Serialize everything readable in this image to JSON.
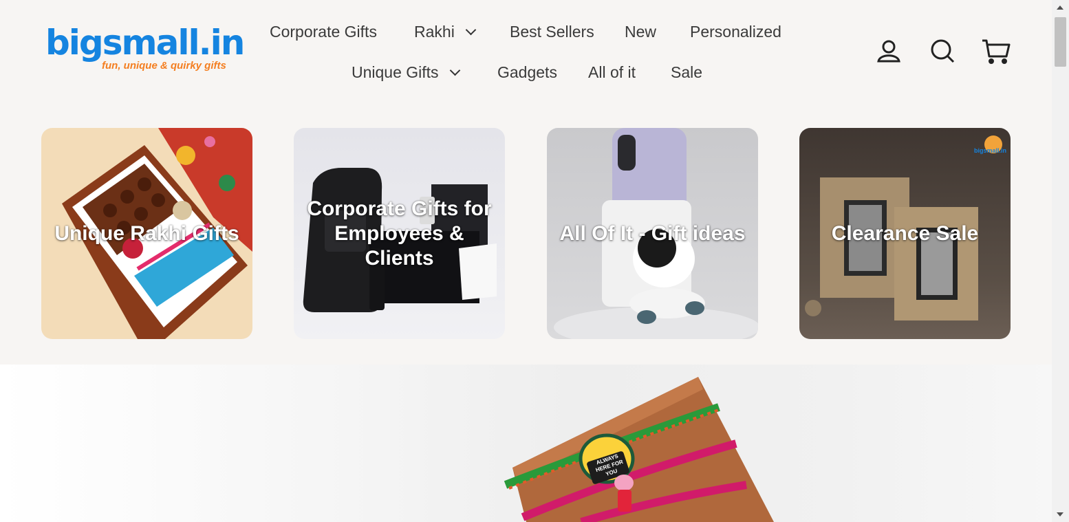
{
  "logo": {
    "name": "bigsmall.in",
    "tagline": "fun, unique & quirky gifts"
  },
  "nav": {
    "row1": [
      "Corporate Gifts",
      "Rakhi",
      "Best Sellers",
      "New",
      "Personalized"
    ],
    "row2": [
      "Unique Gifts",
      "Gadgets",
      "All of it",
      "Sale"
    ]
  },
  "icons": {
    "account": "account-icon",
    "search": "search-icon",
    "cart": "cart-icon"
  },
  "tiles": [
    {
      "label": "Unique Rakhi Gifts"
    },
    {
      "label": "Corporate Gifts for Employees & Clients"
    },
    {
      "label": "All Of It - Gift ideas"
    },
    {
      "label": "Clearance Sale"
    }
  ],
  "tile_watermark": "bigsmall.in",
  "banner": {
    "badge_text": "ALWAYS HERE FOR YOU"
  },
  "colors": {
    "brand_blue": "#1584e0",
    "brand_orange": "#f47e20",
    "header_bg": "#f7f5f3"
  }
}
